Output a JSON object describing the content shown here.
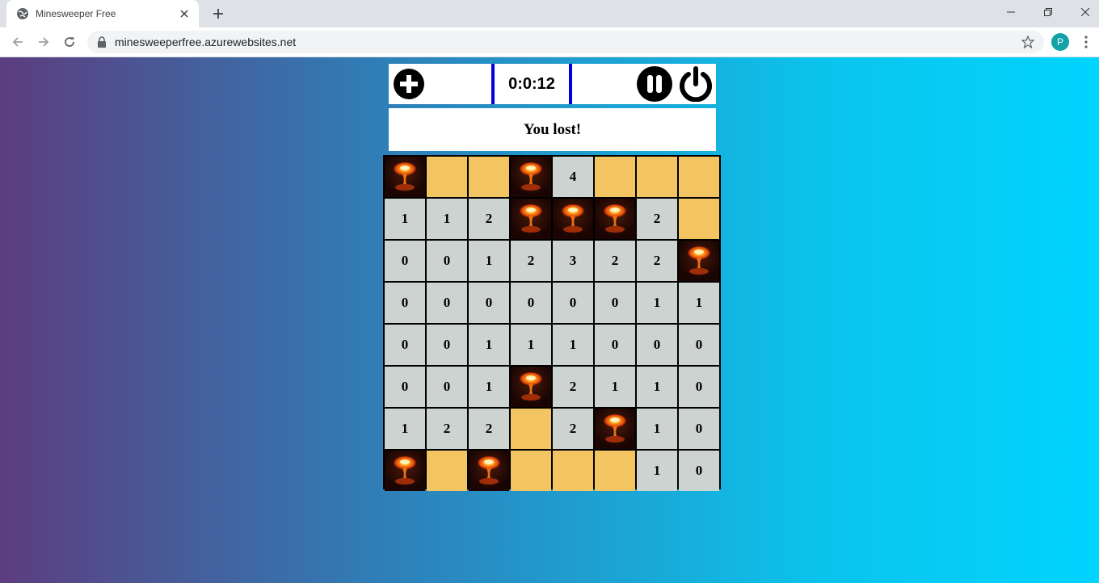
{
  "browser": {
    "tab_title": "Minesweeper Free",
    "url": "minesweeperfree.azurewebsites.net",
    "profile_initial": "P"
  },
  "game": {
    "timer": "0:0:12",
    "status": "You lost!",
    "board": [
      [
        "mine",
        "hidden",
        "hidden",
        "mine",
        "4",
        "hidden",
        "hidden",
        "hidden"
      ],
      [
        "1",
        "1",
        "2",
        "mine",
        "mine",
        "mine",
        "2",
        "hidden"
      ],
      [
        "0",
        "0",
        "1",
        "2",
        "3",
        "2",
        "2",
        "mine"
      ],
      [
        "0",
        "0",
        "0",
        "0",
        "0",
        "0",
        "1",
        "1"
      ],
      [
        "0",
        "0",
        "1",
        "1",
        "1",
        "0",
        "0",
        "0"
      ],
      [
        "0",
        "0",
        "1",
        "mine",
        "2",
        "1",
        "1",
        "0"
      ],
      [
        "1",
        "2",
        "2",
        "hidden",
        "2",
        "mine",
        "1",
        "0"
      ],
      [
        "mine",
        "hidden",
        "mine",
        "hidden",
        "hidden",
        "hidden",
        "1",
        "0"
      ]
    ]
  },
  "colors": {
    "revealed_cell": "#cdd3d0",
    "hidden_cell": "#f2c462",
    "timer_border": "#0000e0"
  }
}
